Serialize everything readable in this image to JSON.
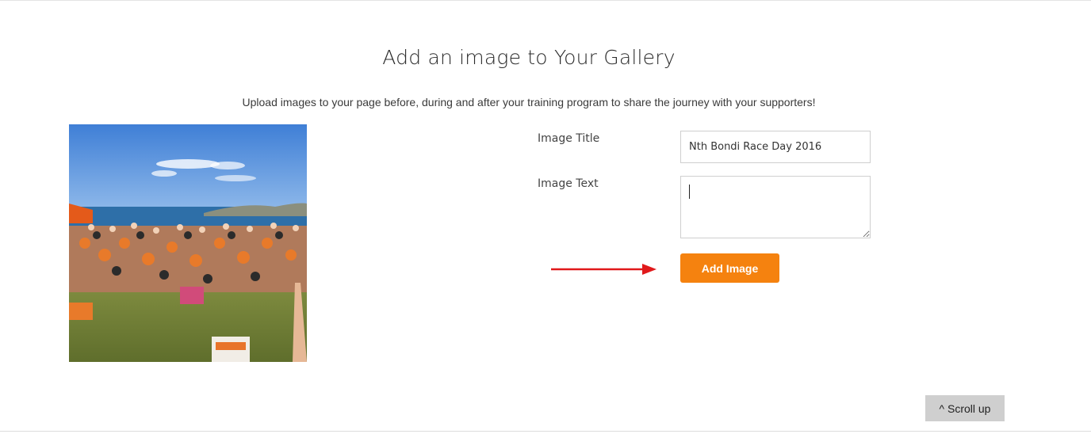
{
  "gallery": {
    "title": "Add an image to Your Gallery",
    "subtitle": "Upload images to your page before, during and after your training program to share the journey with your supporters!"
  },
  "form": {
    "image_title_label": "Image Title",
    "image_title_value": "Nth Bondi Race Day 2016",
    "image_text_label": "Image Text",
    "image_text_value": "",
    "add_button_label": "Add Image"
  },
  "preview": {
    "icon": "beach-crowd-photo"
  },
  "annotation": {
    "arrow_color": "#e0191b",
    "icon": "red-arrow-icon"
  },
  "footer": {
    "scroll_up_label": "^ Scroll up"
  },
  "colors": {
    "accent": "#f5820f",
    "scroll_button": "#cfcfcf"
  }
}
